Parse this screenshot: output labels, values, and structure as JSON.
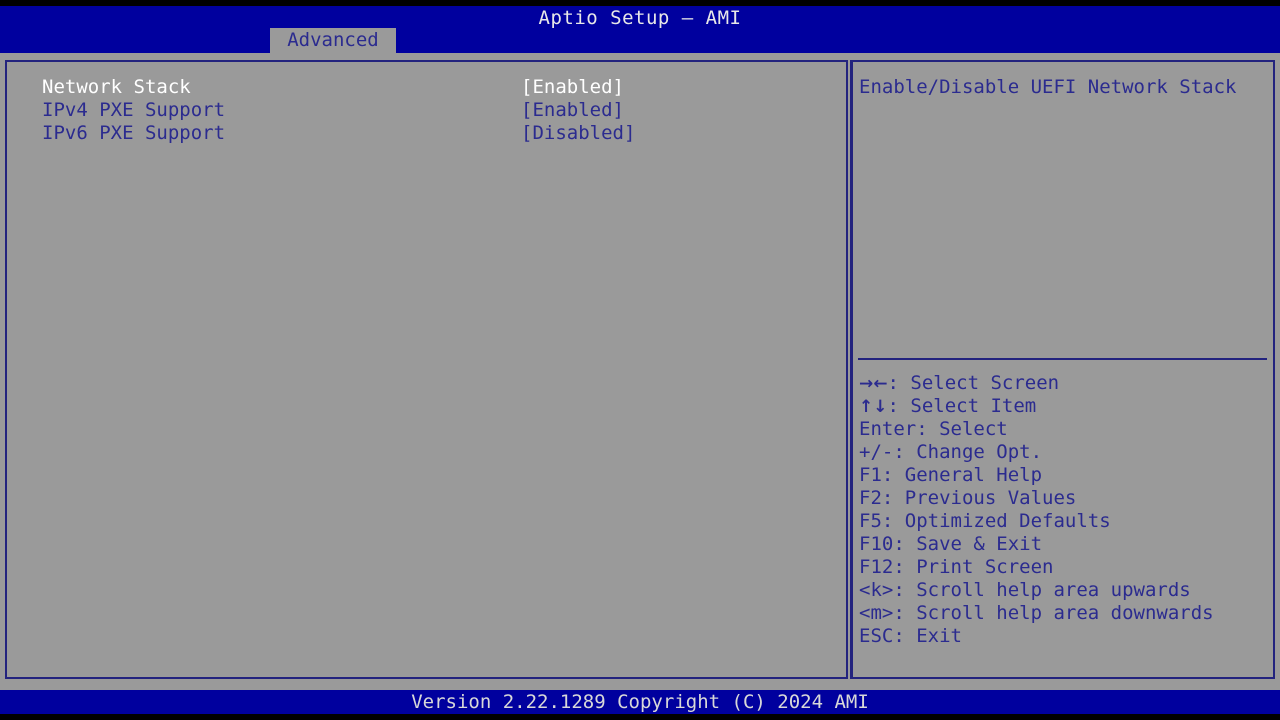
{
  "header": {
    "title": "Aptio Setup – AMI",
    "tab_label": "Advanced"
  },
  "settings": {
    "rows": [
      {
        "label": "Network Stack",
        "value": "[Enabled]",
        "selected": true
      },
      {
        "label": "IPv4 PXE Support",
        "value": "[Enabled]",
        "selected": false
      },
      {
        "label": "IPv6 PXE Support",
        "value": "[Disabled]",
        "selected": false
      }
    ]
  },
  "help": {
    "text": "Enable/Disable UEFI Network Stack",
    "keys": [
      {
        "glyph": "→←",
        "text": ": Select Screen"
      },
      {
        "glyph": "↑↓",
        "text": ": Select Item"
      },
      {
        "glyph": "",
        "text": "Enter: Select"
      },
      {
        "glyph": "",
        "text": "+/-: Change Opt."
      },
      {
        "glyph": "",
        "text": "F1: General Help"
      },
      {
        "glyph": "",
        "text": "F2: Previous Values"
      },
      {
        "glyph": "",
        "text": "F5: Optimized Defaults"
      },
      {
        "glyph": "",
        "text": "F10: Save & Exit"
      },
      {
        "glyph": "",
        "text": "F12: Print Screen"
      },
      {
        "glyph": "",
        "text": "<k>: Scroll help area upwards"
      },
      {
        "glyph": "",
        "text": "<m>: Scroll help area downwards"
      },
      {
        "glyph": "",
        "text": "ESC: Exit"
      }
    ]
  },
  "footer": {
    "version_text": "Version 2.22.1289 Copyright (C) 2024 AMI"
  },
  "colors": {
    "header_blue": "#00009e",
    "panel_gray": "#9a9a9a",
    "text_blue": "#2b2b8f",
    "selected_white": "#ffffff",
    "border_blue": "#23237e"
  }
}
